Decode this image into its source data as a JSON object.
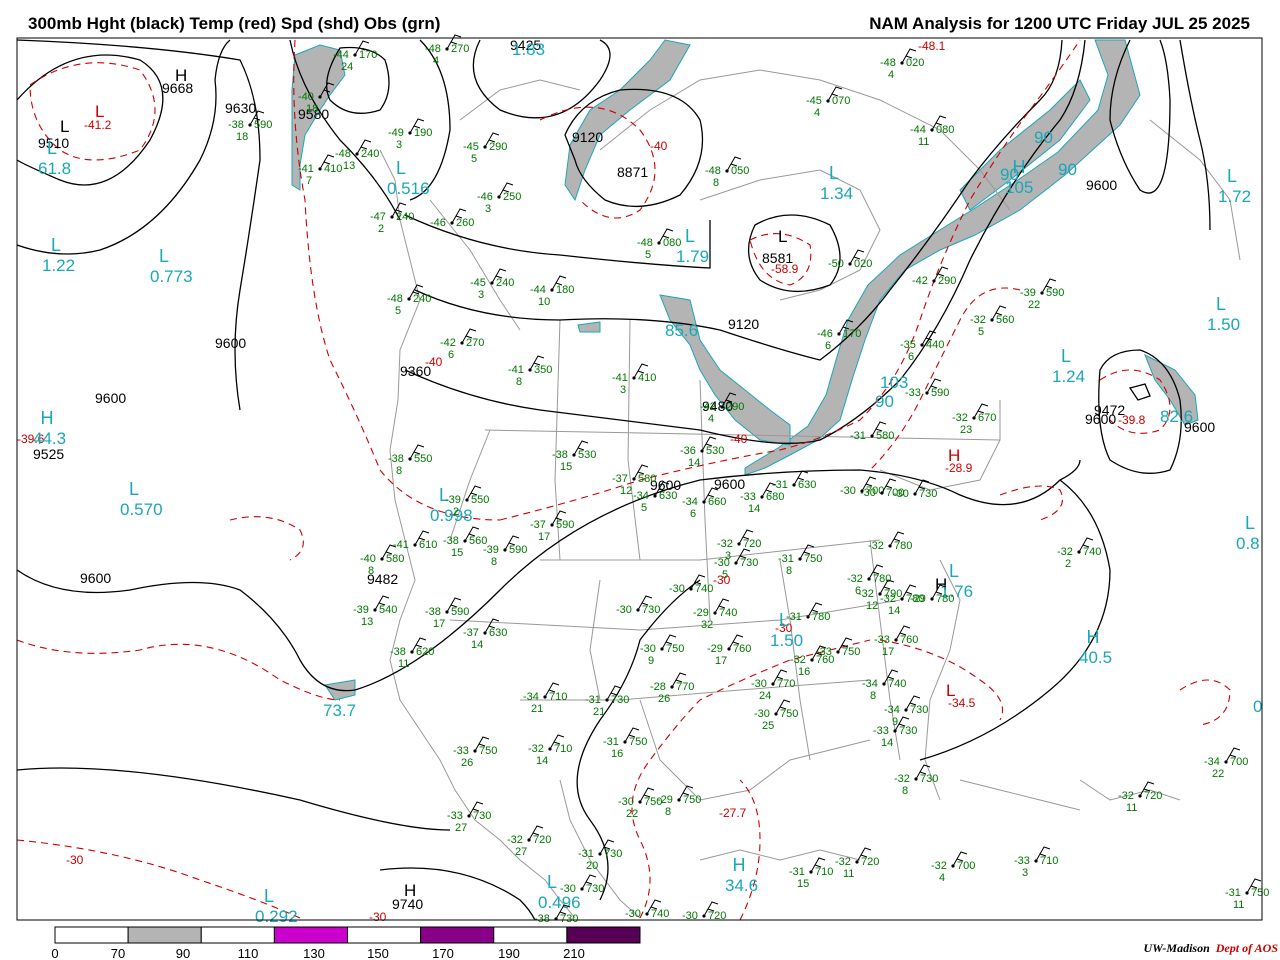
{
  "header": {
    "left_title": "300mb Hght (black) Temp (red) Spd (shd) Obs (grn)",
    "right_title": "NAM Analysis for 1200 UTC Friday  JUL 25 2025"
  },
  "colors": {
    "height": "#000000",
    "temp": "#cc0000",
    "speed_label": "#1aa7b8",
    "obs": "#007700",
    "geography": "#999999",
    "shade": [
      "#ffffff",
      "#b4b4b4",
      "#ffffff",
      "#cc00cc",
      "#ffffff",
      "#880088",
      "#ffffff",
      "#550055"
    ]
  },
  "height_labels": [
    {
      "id": "h1",
      "text": "9668"
    },
    {
      "id": "h2",
      "text": "9510"
    },
    {
      "id": "h3",
      "text": "9630"
    },
    {
      "id": "h4",
      "text": "9580"
    },
    {
      "id": "h5",
      "text": "9425"
    },
    {
      "id": "h6",
      "text": "9120"
    },
    {
      "id": "h7",
      "text": "8871"
    },
    {
      "id": "h8",
      "text": "8581"
    },
    {
      "id": "h9",
      "text": "9120"
    },
    {
      "id": "h10",
      "text": "9600"
    },
    {
      "id": "h11",
      "text": "9600"
    },
    {
      "id": "h12",
      "text": "9525"
    },
    {
      "id": "h13",
      "text": "9480"
    },
    {
      "id": "h14",
      "text": "9360"
    },
    {
      "id": "h15",
      "text": "9600"
    },
    {
      "id": "h16",
      "text": "9600"
    },
    {
      "id": "h17",
      "text": "9482"
    },
    {
      "id": "h18",
      "text": "9600"
    },
    {
      "id": "h19",
      "text": "9472"
    },
    {
      "id": "h20",
      "text": "9600"
    },
    {
      "id": "h21",
      "text": "9600"
    },
    {
      "id": "h22",
      "text": "9740"
    },
    {
      "id": "h23",
      "text": "9600"
    }
  ],
  "centers": [
    {
      "id": "c1",
      "letter": "H",
      "kind": "height"
    },
    {
      "id": "c2",
      "letter": "L",
      "kind": "height"
    },
    {
      "id": "c3",
      "letter": "L",
      "kind": "height"
    },
    {
      "id": "c4",
      "letter": "H",
      "kind": "height"
    },
    {
      "id": "c5",
      "letter": "L",
      "kind": "temp"
    },
    {
      "id": "c6",
      "letter": "H",
      "kind": "temp"
    },
    {
      "id": "c7",
      "letter": "L",
      "kind": "temp"
    },
    {
      "id": "c8",
      "letter": "H",
      "kind": "height"
    }
  ],
  "temp_labels": [
    {
      "id": "t1",
      "text": "-41.2"
    },
    {
      "id": "t2",
      "text": "-48.1"
    },
    {
      "id": "t3",
      "text": "-40"
    },
    {
      "id": "t4",
      "text": "-58.9"
    },
    {
      "id": "t5",
      "text": "-40"
    },
    {
      "id": "t6",
      "text": "-40"
    },
    {
      "id": "t7",
      "text": "-39.6"
    },
    {
      "id": "t8",
      "text": "-39.8"
    },
    {
      "id": "t9",
      "text": "-28.9"
    },
    {
      "id": "t10",
      "text": "-30"
    },
    {
      "id": "t11",
      "text": "-30"
    },
    {
      "id": "t12",
      "text": "-34.5"
    },
    {
      "id": "t13",
      "text": "-27.7"
    },
    {
      "id": "t14",
      "text": "-30"
    },
    {
      "id": "t15",
      "text": "-30"
    }
  ],
  "speed_labels": [
    {
      "id": "s1",
      "letter": "L",
      "value": "61.8"
    },
    {
      "id": "s2",
      "letter": "L",
      "value": "1.22"
    },
    {
      "id": "s3",
      "letter": "L",
      "value": "0.773"
    },
    {
      "id": "s4",
      "letter": "L",
      "value": "0.516"
    },
    {
      "id": "s5",
      "letter": "",
      "value": "1.83"
    },
    {
      "id": "s6",
      "letter": "L",
      "value": "1.79"
    },
    {
      "id": "s7",
      "letter": "L",
      "value": "1.34"
    },
    {
      "id": "s8",
      "letter": "L",
      "value": "1.72"
    },
    {
      "id": "s9",
      "letter": "L",
      "value": "1.50"
    },
    {
      "id": "s10",
      "letter": "L",
      "value": "1.24"
    },
    {
      "id": "s11",
      "letter": "H",
      "value": "44.3"
    },
    {
      "id": "s12",
      "letter": "L",
      "value": "0.570"
    },
    {
      "id": "s13",
      "letter": "L",
      "value": "0.998"
    },
    {
      "id": "s14",
      "letter": "H",
      "value": "105"
    },
    {
      "id": "s15",
      "letter": "",
      "value": "90"
    },
    {
      "id": "s16",
      "letter": "",
      "value": "90"
    },
    {
      "id": "s17",
      "letter": "",
      "value": "90"
    },
    {
      "id": "s18",
      "letter": "",
      "value": "85.6"
    },
    {
      "id": "s19",
      "letter": "",
      "value": "103"
    },
    {
      "id": "s20",
      "letter": "",
      "value": "90"
    },
    {
      "id": "s21",
      "letter": "H",
      "value": "40.5"
    },
    {
      "id": "s22",
      "letter": "L",
      "value": "1.50"
    },
    {
      "id": "s23",
      "letter": "L",
      "value": "1.76"
    },
    {
      "id": "s24",
      "letter": "",
      "value": "73.7"
    },
    {
      "id": "s25",
      "letter": "H",
      "value": "34.6"
    },
    {
      "id": "s26",
      "letter": "L",
      "value": "0.292"
    },
    {
      "id": "s27",
      "letter": "L",
      "value": "0.496"
    },
    {
      "id": "s28",
      "letter": "",
      "value": "82.6"
    },
    {
      "id": "s29",
      "letter": "L",
      "value": "0.8"
    },
    {
      "id": "s30",
      "letter": "",
      "value": "0"
    }
  ],
  "observations": [
    {
      "temp": "-44",
      "hght": "170",
      "dew": "24"
    },
    {
      "temp": "-48",
      "hght": "270",
      "dew": "4"
    },
    {
      "temp": "-40",
      "hght": "",
      "dew": "18"
    },
    {
      "temp": "-38",
      "hght": "590",
      "dew": "18"
    },
    {
      "temp": "-49",
      "hght": "190",
      "dew": "3"
    },
    {
      "temp": "-45",
      "hght": "290",
      "dew": "5"
    },
    {
      "temp": "-48",
      "hght": "240",
      "dew": "13"
    },
    {
      "temp": "-41",
      "hght": "410",
      "dew": "7"
    },
    {
      "temp": "-46",
      "hght": "250",
      "dew": "3"
    },
    {
      "temp": "-47",
      "hght": "240",
      "dew": "2"
    },
    {
      "temp": "-46",
      "hght": "260",
      "dew": ""
    },
    {
      "temp": "-48",
      "hght": "080",
      "dew": "5"
    },
    {
      "temp": "-48",
      "hght": "050",
      "dew": "8"
    },
    {
      "temp": "-45",
      "hght": "070",
      "dew": "4"
    },
    {
      "temp": "-48",
      "hght": "020",
      "dew": "4"
    },
    {
      "temp": "-44",
      "hght": "080",
      "dew": "11"
    },
    {
      "temp": "-45",
      "hght": "240",
      "dew": "3"
    },
    {
      "temp": "-44",
      "hght": "180",
      "dew": "10"
    },
    {
      "temp": "-48",
      "hght": "240",
      "dew": "5"
    },
    {
      "temp": "-42",
      "hght": "270",
      "dew": "6"
    },
    {
      "temp": "-50",
      "hght": "020",
      "dew": ""
    },
    {
      "temp": "-42",
      "hght": "290",
      "dew": ""
    },
    {
      "temp": "-39",
      "hght": "590",
      "dew": "22"
    },
    {
      "temp": "-32",
      "hght": "560",
      "dew": "5"
    },
    {
      "temp": "-46",
      "hght": "170",
      "dew": "6"
    },
    {
      "temp": "-35",
      "hght": "440",
      "dew": "6"
    },
    {
      "temp": "-41",
      "hght": "350",
      "dew": "8"
    },
    {
      "temp": "-41",
      "hght": "410",
      "dew": "3"
    },
    {
      "temp": "-42",
      "hght": "290",
      "dew": "4"
    },
    {
      "temp": "-33",
      "hght": "590",
      "dew": ""
    },
    {
      "temp": "-32",
      "hght": "670",
      "dew": "23"
    },
    {
      "temp": "-31",
      "hght": "580",
      "dew": ""
    },
    {
      "temp": "-38",
      "hght": "530",
      "dew": "15"
    },
    {
      "temp": "-36",
      "hght": "530",
      "dew": "14"
    },
    {
      "temp": "-38",
      "hght": "550",
      "dew": "8"
    },
    {
      "temp": "-37",
      "hght": "580",
      "dew": "12"
    },
    {
      "temp": "-34",
      "hght": "630",
      "dew": "5"
    },
    {
      "temp": "-34",
      "hght": "660",
      "dew": "6"
    },
    {
      "temp": "-33",
      "hght": "680",
      "dew": "14"
    },
    {
      "temp": "-31",
      "hght": "630",
      "dew": ""
    },
    {
      "temp": "-30",
      "hght": "700",
      "dew": ""
    },
    {
      "temp": "-30",
      "hght": "730",
      "dew": ""
    },
    {
      "temp": "-39",
      "hght": "550",
      "dew": "2"
    },
    {
      "temp": "-37",
      "hght": "590",
      "dew": "17"
    },
    {
      "temp": "-38",
      "hght": "560",
      "dew": "15"
    },
    {
      "temp": "-39",
      "hght": "590",
      "dew": "8"
    },
    {
      "temp": "-41",
      "hght": "610",
      "dew": ""
    },
    {
      "temp": "-40",
      "hght": "580",
      "dew": "8"
    },
    {
      "temp": "-32",
      "hght": "720",
      "dew": "3"
    },
    {
      "temp": "-30",
      "hght": "730",
      "dew": "5"
    },
    {
      "temp": "-31",
      "hght": "750",
      "dew": "8"
    },
    {
      "temp": "-32",
      "hght": "780",
      "dew": "6"
    },
    {
      "temp": "-30",
      "hght": "740",
      "dew": ""
    },
    {
      "temp": "-30",
      "hght": "730",
      "dew": ""
    },
    {
      "temp": "-29",
      "hght": "740",
      "dew": "32"
    },
    {
      "temp": "-31",
      "hght": "780",
      "dew": ""
    },
    {
      "temp": "-30",
      "hght": "750",
      "dew": "9"
    },
    {
      "temp": "-29",
      "hght": "760",
      "dew": "17"
    },
    {
      "temp": "-32",
      "hght": "760",
      "dew": "16"
    },
    {
      "temp": "-33",
      "hght": "750",
      "dew": ""
    },
    {
      "temp": "-33",
      "hght": "760",
      "dew": "17"
    },
    {
      "temp": "-28",
      "hght": "770",
      "dew": "26"
    },
    {
      "temp": "-30",
      "hght": "770",
      "dew": "24"
    },
    {
      "temp": "-34",
      "hght": "740",
      "dew": "8"
    },
    {
      "temp": "-34",
      "hght": "730",
      "dew": "9"
    },
    {
      "temp": "-33",
      "hght": "730",
      "dew": "14"
    },
    {
      "temp": "-30",
      "hght": "750",
      "dew": "25"
    },
    {
      "temp": "-32",
      "hght": "730",
      "dew": "8"
    },
    {
      "temp": "-39",
      "hght": "540",
      "dew": "13"
    },
    {
      "temp": "-38",
      "hght": "590",
      "dew": "17"
    },
    {
      "temp": "-37",
      "hght": "630",
      "dew": "14"
    },
    {
      "temp": "-38",
      "hght": "620",
      "dew": "11"
    },
    {
      "temp": "-34",
      "hght": "710",
      "dew": "21"
    },
    {
      "temp": "-31",
      "hght": "730",
      "dew": "21"
    },
    {
      "temp": "-33",
      "hght": "750",
      "dew": "26"
    },
    {
      "temp": "-32",
      "hght": "710",
      "dew": "14"
    },
    {
      "temp": "-31",
      "hght": "750",
      "dew": "16"
    },
    {
      "temp": "-30",
      "hght": "750",
      "dew": "22"
    },
    {
      "temp": "-29",
      "hght": "750",
      "dew": "8"
    },
    {
      "temp": "-33",
      "hght": "730",
      "dew": "27"
    },
    {
      "temp": "-32",
      "hght": "720",
      "dew": "27"
    },
    {
      "temp": "-31",
      "hght": "730",
      "dew": "20"
    },
    {
      "temp": "-30",
      "hght": "730",
      "dew": ""
    },
    {
      "temp": "-38",
      "hght": "730",
      "dew": ""
    },
    {
      "temp": "-30",
      "hght": "740",
      "dew": ""
    },
    {
      "temp": "-30",
      "hght": "720",
      "dew": ""
    },
    {
      "temp": "-31",
      "hght": "710",
      "dew": "15"
    },
    {
      "temp": "-32",
      "hght": "720",
      "dew": "11"
    },
    {
      "temp": "-32",
      "hght": "700",
      "dew": "4"
    },
    {
      "temp": "-33",
      "hght": "710",
      "dew": "3"
    },
    {
      "temp": "-32",
      "hght": "740",
      "dew": "2"
    },
    {
      "temp": "-34",
      "hght": "700",
      "dew": "22"
    },
    {
      "temp": "-32",
      "hght": "720",
      "dew": "11"
    },
    {
      "temp": "-31",
      "hght": "750",
      "dew": "11"
    },
    {
      "temp": "-30",
      "hght": "700",
      "dew": ""
    },
    {
      "temp": "-32",
      "hght": "780",
      "dew": ""
    },
    {
      "temp": "-32",
      "hght": "790",
      "dew": "12"
    },
    {
      "temp": "-32",
      "hght": "780",
      "dew": "14"
    },
    {
      "temp": "-29",
      "hght": "780",
      "dew": ""
    }
  ],
  "legend": {
    "ticks": [
      "0",
      "70",
      "90",
      "110",
      "130",
      "150",
      "170",
      "190",
      "210"
    ]
  },
  "credit": {
    "org": "UW-Madison",
    "dept": "Dept of AOS"
  }
}
